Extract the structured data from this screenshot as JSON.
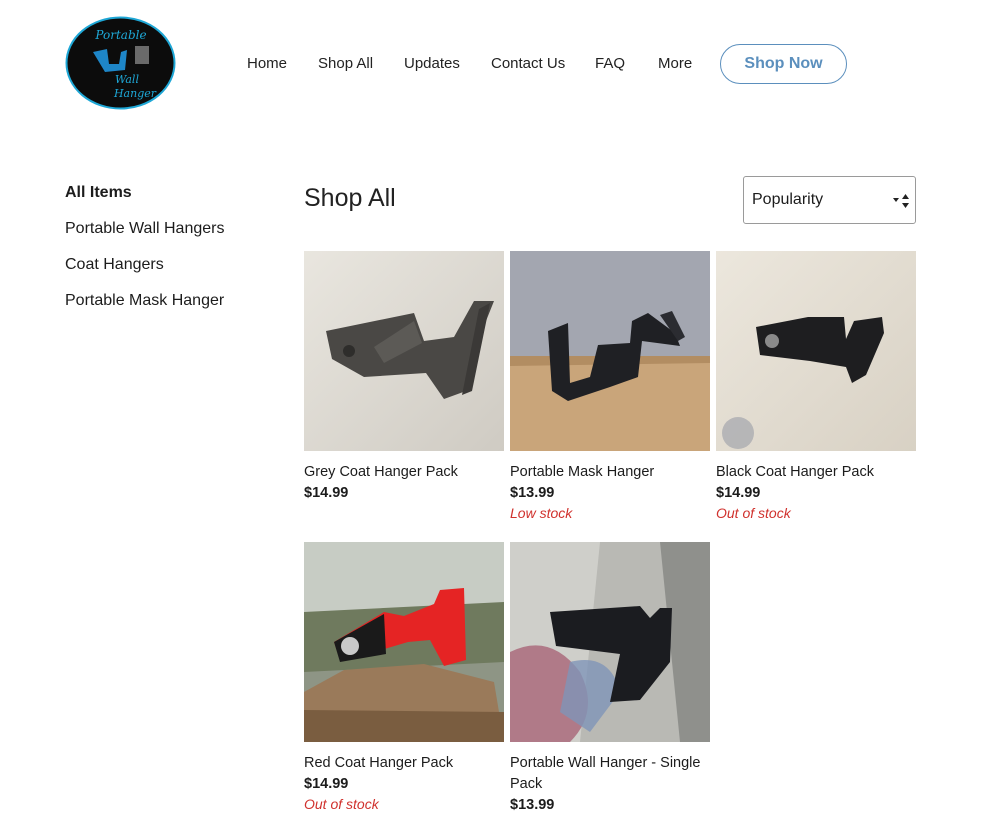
{
  "logo": {
    "line1": "Portable",
    "line2": "Wall",
    "line3": "Hanger",
    "bg": "#0c0c0c",
    "ring": "#1ea7d6",
    "text": "#1ea7d6"
  },
  "nav": {
    "items": [
      "Home",
      "Shop All",
      "Updates",
      "Contact Us",
      "FAQ",
      "More"
    ],
    "cta": "Shop Now"
  },
  "sidebar": {
    "items": [
      "All Items",
      "Portable Wall Hangers",
      "Coat Hangers",
      "Portable Mask Hanger"
    ]
  },
  "main": {
    "title": "Shop All",
    "sort": {
      "selected": "Popularity"
    }
  },
  "products": [
    {
      "name": "Grey Coat Hanger Pack",
      "price": "$14.99",
      "stock": ""
    },
    {
      "name": "Portable Mask Hanger",
      "price": "$13.99",
      "stock": "Low stock"
    },
    {
      "name": "Black Coat Hanger Pack",
      "price": "$14.99",
      "stock": "Out of stock"
    },
    {
      "name": "Red Coat Hanger Pack",
      "price": "$14.99",
      "stock": "Out of stock"
    },
    {
      "name": "Portable Wall Hanger - Single Pack",
      "price": "$13.99",
      "stock": ""
    }
  ],
  "colors": {
    "accent": "#5b8fbd",
    "stock_warning": "#d0312d"
  }
}
